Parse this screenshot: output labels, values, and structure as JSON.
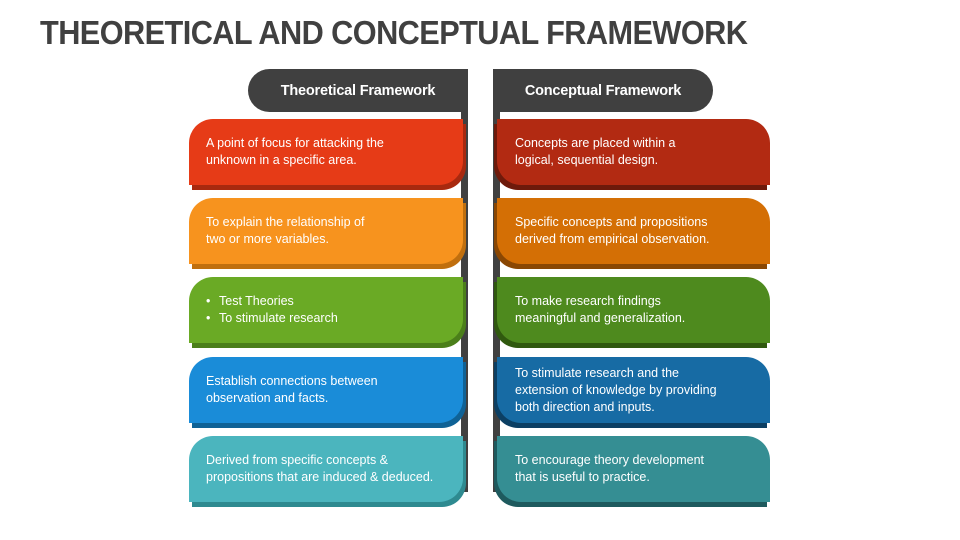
{
  "title": "THEORETICAL AND CONCEPTUAL FRAMEWORK",
  "colors": {
    "dark": "#404040",
    "left": [
      "#E63B17",
      "#F7931E",
      "#6AAA25",
      "#1A8CD8",
      "#4BB5BE"
    ],
    "left_shadow": [
      "#A8290F",
      "#C06F0E",
      "#4B7F1A",
      "#0F6296",
      "#2E8A90"
    ],
    "right": [
      "#B22A12",
      "#D46F05",
      "#4E8A1E",
      "#176BA4",
      "#358E93"
    ],
    "right_shadow": [
      "#6E1A0B",
      "#8A4703",
      "#30590F",
      "#0C3F63",
      "#1E5A5E"
    ]
  },
  "theoretical": {
    "header": "Theoretical Framework",
    "items": [
      {
        "lines": [
          "A point of focus for attacking the",
          "unknown in a specific area."
        ]
      },
      {
        "lines": [
          "To explain the relationship of",
          "two or more variables."
        ]
      },
      {
        "bullets": [
          "Test Theories",
          "To stimulate research"
        ]
      },
      {
        "lines": [
          "Establish connections between",
          "observation and facts."
        ]
      },
      {
        "lines": [
          "Derived from specific concepts &",
          "propositions that are induced & deduced."
        ]
      }
    ]
  },
  "conceptual": {
    "header": "Conceptual Framework",
    "items": [
      {
        "lines": [
          "Concepts are placed within a",
          "logical, sequential design."
        ]
      },
      {
        "lines": [
          "Specific concepts and propositions",
          "derived from empirical observation."
        ]
      },
      {
        "lines": [
          "To make research findings",
          "meaningful and generalization."
        ]
      },
      {
        "lines": [
          "To stimulate research and the",
          "extension of knowledge by providing",
          "both direction and inputs."
        ]
      },
      {
        "lines": [
          "To encourage theory development",
          "that is useful to practice."
        ]
      }
    ]
  }
}
